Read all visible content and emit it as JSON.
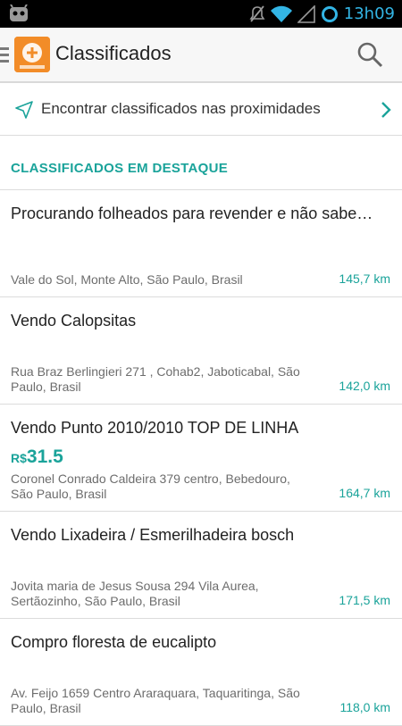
{
  "status_bar": {
    "time": "13h09"
  },
  "app_bar": {
    "title": "Classificados"
  },
  "nearby": {
    "label": "Encontrar classificados nas proximidades"
  },
  "section": {
    "title": "CLASSIFICADOS EM DESTAQUE"
  },
  "items": [
    {
      "title": "Procurando folheados para revender e não sabe…",
      "location": "Vale do Sol, Monte Alto, São Paulo, Brasil",
      "distance": "145,7 km"
    },
    {
      "title": "Vendo Calopsitas",
      "location": "Rua Braz Berlingieri  271 , Cohab2, Jaboticabal, São Paulo, Brasil",
      "distance": "142,0 km"
    },
    {
      "title": "Vendo Punto 2010/2010 TOP DE LINHA",
      "price_currency": "R$",
      "price_amount": "31.5",
      "location": "Coronel Conrado Caldeira 379 centro, Bebedouro, São Paulo, Brasil",
      "distance": "164,7 km"
    },
    {
      "title": "Vendo Lixadeira / Esmerilhadeira bosch",
      "location": "Jovita maria de Jesus Sousa 294 Vila Aurea, Sertãozinho, São Paulo, Brasil",
      "distance": "171,5 km"
    },
    {
      "title": "Compro floresta de eucalipto",
      "location": "Av. Feijo 1659 Centro Araraquara, Taquaritinga, São Paulo, Brasil",
      "distance": "118,0 km"
    }
  ],
  "colors": {
    "accent": "#1aa39a",
    "status_accent": "#33b5e5",
    "logo": "#f28c28"
  },
  "icons": [
    "notification-android-icon",
    "mute-icon",
    "wifi-icon",
    "signal-icon",
    "sync-ring-icon",
    "menu-icon",
    "app-logo-icon",
    "search-icon",
    "location-arrow-icon",
    "chevron-right-icon"
  ]
}
